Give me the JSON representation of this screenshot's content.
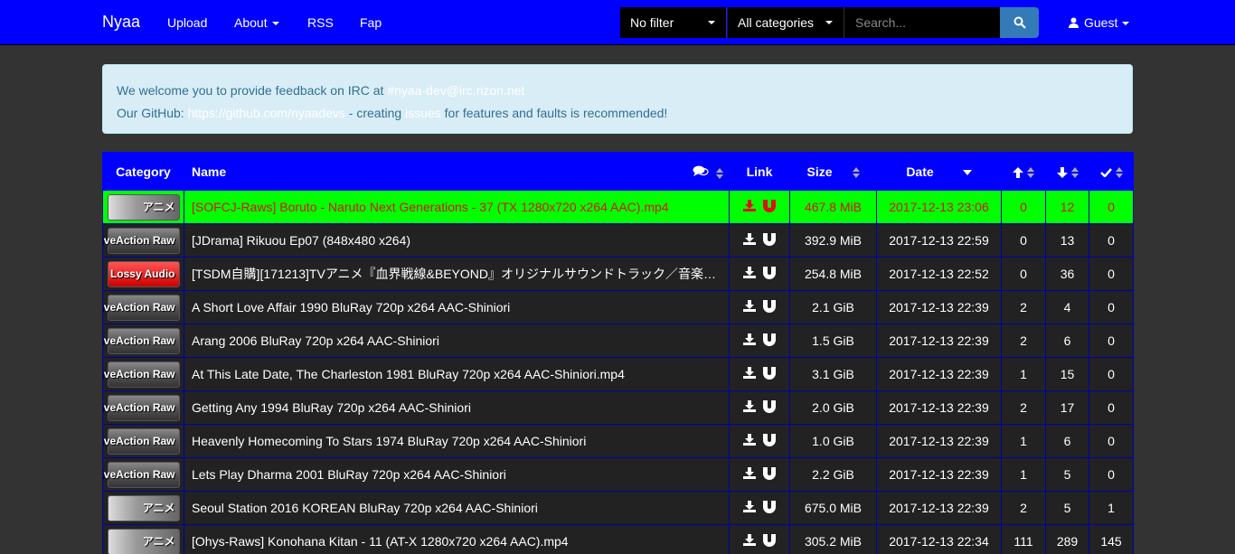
{
  "navbar": {
    "brand": "Nyaa",
    "links": [
      "Upload",
      "About",
      "RSS",
      "Fap"
    ],
    "filter": "No filter",
    "category": "All categories",
    "search_placeholder": "Search...",
    "user": "Guest"
  },
  "alert": {
    "line1_text": "We welcome you to provide feedback on IRC at ",
    "line1_link": "#nyaa-dev@irc.rizon.net",
    "line2_text1": "Our GitHub: ",
    "line2_link": "https://github.com/nyaadevs",
    "line2_text2": " - creating ",
    "line2_link2": "issues",
    "line2_text3": " for features and faults is recommended!"
  },
  "table": {
    "headers": {
      "category": "Category",
      "name": "Name",
      "link": "Link",
      "size": "Size",
      "date": "Date"
    },
    "rows": [
      {
        "cat": "アニメ",
        "cat_type": "anime",
        "name": "[SOFCJ-Raws] Boruto - Naruto Next Generations - 37 (TX 1280x720 x264 AAC).mp4",
        "size": "467.8 MiB",
        "date": "2017-12-13 23:06",
        "seeders": "0",
        "leechers": "12",
        "completed": "0",
        "highlight": true
      },
      {
        "cat": "LiveAction Raw",
        "cat_type": "live",
        "name": "[JDrama] Rikuou Ep07 (848x480 x264)",
        "size": "392.9 MiB",
        "date": "2017-12-13 22:59",
        "seeders": "0",
        "leechers": "13",
        "completed": "0"
      },
      {
        "cat": "Lossy Audio",
        "cat_type": "audio",
        "name": "[TSDM自購][171213]TVアニメ『血界戦線&BEYOND』オリジナルサウンドトラック／音楽…",
        "size": "254.8 MiB",
        "date": "2017-12-13 22:52",
        "seeders": "0",
        "leechers": "36",
        "completed": "0"
      },
      {
        "cat": "LiveAction Raw",
        "cat_type": "live",
        "name": "A Short Love Affair 1990 BluRay 720p x264 AAC-Shiniori",
        "size": "2.1 GiB",
        "date": "2017-12-13 22:39",
        "seeders": "2",
        "leechers": "4",
        "completed": "0"
      },
      {
        "cat": "LiveAction Raw",
        "cat_type": "live",
        "name": "Arang 2006 BluRay 720p x264 AAC-Shiniori",
        "size": "1.5 GiB",
        "date": "2017-12-13 22:39",
        "seeders": "2",
        "leechers": "6",
        "completed": "0"
      },
      {
        "cat": "LiveAction Raw",
        "cat_type": "live",
        "name": "At This Late Date, The Charleston 1981 BluRay 720p x264 AAC-Shiniori.mp4",
        "size": "3.1 GiB",
        "date": "2017-12-13 22:39",
        "seeders": "1",
        "leechers": "15",
        "completed": "0"
      },
      {
        "cat": "LiveAction Raw",
        "cat_type": "live",
        "name": "Getting Any 1994 BluRay 720p x264 AAC-Shiniori",
        "size": "2.0 GiB",
        "date": "2017-12-13 22:39",
        "seeders": "2",
        "leechers": "17",
        "completed": "0"
      },
      {
        "cat": "LiveAction Raw",
        "cat_type": "live",
        "name": "Heavenly Homecoming To Stars 1974 BluRay 720p x264 AAC-Shiniori",
        "size": "1.0 GiB",
        "date": "2017-12-13 22:39",
        "seeders": "1",
        "leechers": "6",
        "completed": "0"
      },
      {
        "cat": "LiveAction Raw",
        "cat_type": "live",
        "name": "Lets Play Dharma 2001 BluRay 720p x264 AAC-Shiniori",
        "size": "2.2 GiB",
        "date": "2017-12-13 22:39",
        "seeders": "1",
        "leechers": "5",
        "completed": "0"
      },
      {
        "cat": "アニメ",
        "cat_type": "anime",
        "name": "Seoul Station 2016 KOREAN BluRay 720p x264 AAC-Shiniori",
        "size": "675.0 MiB",
        "date": "2017-12-13 22:39",
        "seeders": "2",
        "leechers": "5",
        "completed": "1"
      },
      {
        "cat": "アニメ",
        "cat_type": "anime",
        "name": "[Ohys-Raws] Konohana Kitan - 11 (AT-X 1280x720 x264 AAC).mp4",
        "size": "305.2 MiB",
        "date": "2017-12-13 22:34",
        "seeders": "111",
        "leechers": "289",
        "completed": "145"
      }
    ]
  },
  "colors": {
    "navbar": "#0000ff",
    "highlight": "#00ff00",
    "background": "#333333"
  },
  "icons": [
    "search-icon",
    "user-icon",
    "comments-icon",
    "sort-icon",
    "download-icon",
    "magnet-icon",
    "arrow-up-icon",
    "arrow-down-icon",
    "check-icon"
  ]
}
